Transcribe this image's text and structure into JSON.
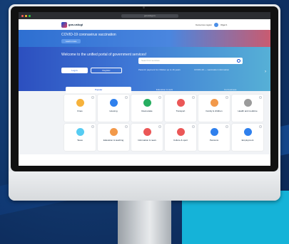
{
  "browser": {
    "url": "gosuslugi.ru"
  },
  "header": {
    "logo_text": "gos.uslugi",
    "right_text": "Kemerovo region",
    "user_name": "Olga K."
  },
  "covid": {
    "title": "COVID-19 coronavirus vaccination",
    "button": "Learn more"
  },
  "hero": {
    "title": "Welcome to the unified portal of government services!",
    "login_button": "Log in",
    "register_button": "Register",
    "search_placeholder": "Search for services",
    "link1": "Parents' payment for children up to 16 years",
    "link2": "COVID-19 — vaccination information"
  },
  "tabs": [
    {
      "label": "Popular"
    },
    {
      "label": "Education & work"
    },
    {
      "label": "For business"
    }
  ],
  "services": [
    {
      "label": "Fines",
      "color": "#f6b23c"
    },
    {
      "label": "Housing",
      "color": "#2f80ed"
    },
    {
      "label": "Real estate",
      "color": "#27ae60"
    },
    {
      "label": "Transport",
      "color": "#eb5757"
    },
    {
      "label": "Family & children",
      "color": "#f2994a"
    },
    {
      "label": "Health and medicine",
      "color": "#9b9b9b"
    },
    {
      "label": "Taxes",
      "color": "#56ccf2"
    },
    {
      "label": "Education & teaching",
      "color": "#f2994a"
    },
    {
      "label": "Information & news",
      "color": "#eb5757"
    },
    {
      "label": "Culture & sport",
      "color": "#eb5757"
    },
    {
      "label": "Pensions",
      "color": "#2f80ed"
    },
    {
      "label": "Employment",
      "color": "#2f80ed"
    }
  ]
}
